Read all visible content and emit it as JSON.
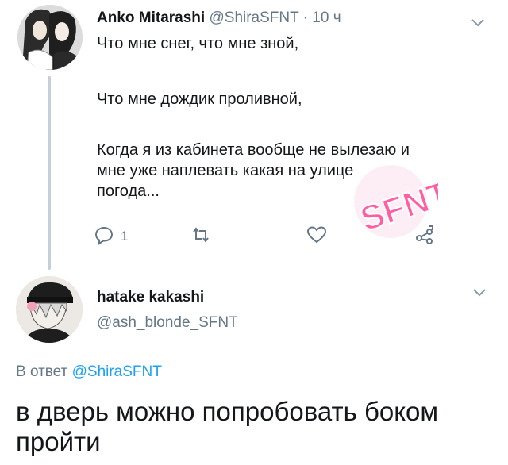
{
  "tweet": {
    "author_name": "Anko Mitarashi",
    "author_handle": "@ShiraSFNT",
    "separator": " · ",
    "time": "10 ч",
    "lines": [
      "Что мне снег, что мне зной,",
      "Что мне дождик проливной,",
      "Когда я из кабинета вообще не вылезаю и",
      "мне уже наплевать какая на улице",
      "погода..."
    ],
    "reply_count": "1",
    "watermark_text": "SFNT"
  },
  "reply": {
    "author_name": "hatake kakashi",
    "author_handle": "@ash_blonde_SFNT",
    "reply_prefix": "В ответ ",
    "reply_to": "@ShiraSFNT",
    "text": "в дверь можно попробовать боком пройти"
  },
  "icons": {
    "more": "chevron-down-icon",
    "reply": "reply-icon",
    "retweet": "retweet-icon",
    "like": "heart-icon",
    "share": "share-icon"
  },
  "colors": {
    "text": "#14171a",
    "secondary": "#657786",
    "link": "#1da1f2",
    "thread_line": "#c4cfd6",
    "watermark": "#ff5fa2"
  }
}
